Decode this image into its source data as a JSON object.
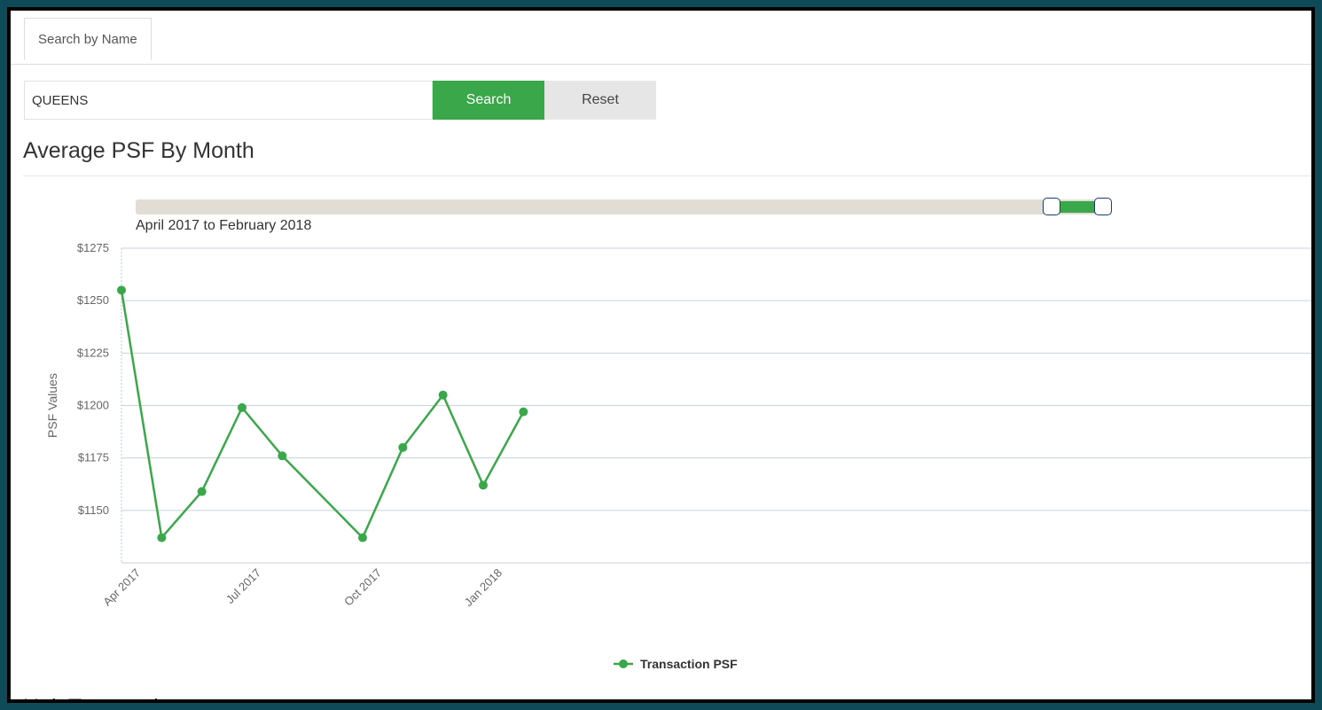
{
  "tabs": [
    {
      "label": "Search by Name"
    }
  ],
  "search": {
    "value": "QUEENS",
    "search_label": "Search",
    "reset_label": "Reset"
  },
  "section": {
    "title": "Average PSF By Month",
    "next_title": "Unit Transactions"
  },
  "slider": {
    "range_label": "April 2017 to February 2018"
  },
  "colors": {
    "accent": "#3aa84a",
    "grid": "#c9d1dc"
  },
  "chart_data": {
    "type": "line",
    "ylabel": "PSF Values",
    "xlabel": "",
    "ylim": [
      1125,
      1275
    ],
    "yticks": [
      1150,
      1175,
      1200,
      1225,
      1250,
      1275
    ],
    "ytick_prefix": "$",
    "xtick_labels": [
      "Apr 2017",
      "Jul 2017",
      "Oct 2017",
      "Jan 2018"
    ],
    "xtick_months": [
      0,
      3,
      6,
      9
    ],
    "series": [
      {
        "name": "Transaction PSF",
        "color": "#3aa84a",
        "points": [
          {
            "month": 0,
            "value": 1255
          },
          {
            "month": 1,
            "value": 1137
          },
          {
            "month": 2,
            "value": 1159
          },
          {
            "month": 3,
            "value": 1199
          },
          {
            "month": 4,
            "value": 1176
          },
          {
            "month": 6,
            "value": 1137
          },
          {
            "month": 7,
            "value": 1180
          },
          {
            "month": 8,
            "value": 1205
          },
          {
            "month": 9,
            "value": 1162
          },
          {
            "month": 10,
            "value": 1197
          }
        ]
      }
    ]
  }
}
